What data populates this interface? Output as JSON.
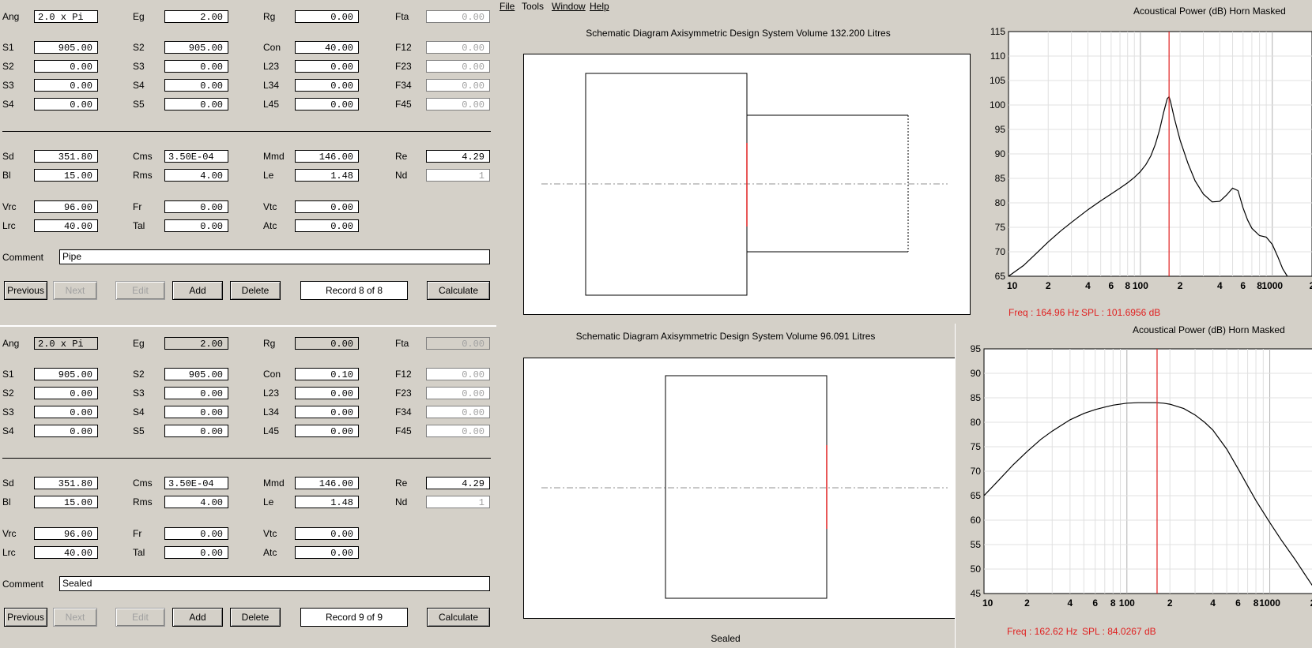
{
  "menu": {
    "file": "File",
    "tools": "Tools",
    "window": "Window",
    "help": "Help"
  },
  "records": [
    {
      "fields": [
        [
          {
            "label": "Ang",
            "value": "2.0 x Pi",
            "align": "left"
          },
          {
            "label": "Eg",
            "value": "2.00"
          },
          {
            "label": "Rg",
            "value": "0.00"
          },
          {
            "label": "Fta",
            "value": "0.00",
            "disabled": true
          }
        ],
        [
          {
            "label": "S1",
            "value": "905.00"
          },
          {
            "label": "S2",
            "value": "905.00"
          },
          {
            "label": "Con",
            "value": "40.00"
          },
          {
            "label": "F12",
            "value": "0.00",
            "disabled": true
          }
        ],
        [
          {
            "label": "S2",
            "value": "0.00"
          },
          {
            "label": "S3",
            "value": "0.00"
          },
          {
            "label": "L23",
            "value": "0.00"
          },
          {
            "label": "F23",
            "value": "0.00",
            "disabled": true
          }
        ],
        [
          {
            "label": "S3",
            "value": "0.00"
          },
          {
            "label": "S4",
            "value": "0.00"
          },
          {
            "label": "L34",
            "value": "0.00"
          },
          {
            "label": "F34",
            "value": "0.00",
            "disabled": true
          }
        ],
        [
          {
            "label": "S4",
            "value": "0.00"
          },
          {
            "label": "S5",
            "value": "0.00"
          },
          {
            "label": "L45",
            "value": "0.00"
          },
          {
            "label": "F45",
            "value": "0.00",
            "disabled": true
          }
        ],
        [
          {
            "label": "Sd",
            "value": "351.80"
          },
          {
            "label": "Cms",
            "value": "3.50E-04",
            "align": "left"
          },
          {
            "label": "Mmd",
            "value": "146.00"
          },
          {
            "label": "Re",
            "value": "4.29"
          }
        ],
        [
          {
            "label": "Bl",
            "value": "15.00"
          },
          {
            "label": "Rms",
            "value": "4.00"
          },
          {
            "label": "Le",
            "value": "1.48"
          },
          {
            "label": "Nd",
            "value": "1",
            "disabled": true
          }
        ],
        [
          {
            "label": "Vrc",
            "value": "96.00"
          },
          {
            "label": "Fr",
            "value": "0.00"
          },
          {
            "label": "Vtc",
            "value": "0.00"
          }
        ],
        [
          {
            "label": "Lrc",
            "value": "40.00"
          },
          {
            "label": "Tal",
            "value": "0.00"
          },
          {
            "label": "Atc",
            "value": "0.00"
          }
        ]
      ],
      "comment_label": "Comment",
      "comment": "Pipe",
      "buttons": {
        "previous": "Previous",
        "next": "Next",
        "edit": "Edit",
        "add": "Add",
        "delete": "Delete",
        "calculate": "Calculate"
      },
      "record": "Record 8 of 8",
      "schematic_caption": "Schematic Diagram   Axisymmetric Design   System Volume 132.200 Litres",
      "footer": ""
    },
    {
      "fields": [
        [
          {
            "label": "Ang",
            "value": "2.0 x Pi",
            "align": "left",
            "gray": true
          },
          {
            "label": "Eg",
            "value": "2.00",
            "gray": true
          },
          {
            "label": "Rg",
            "value": "0.00",
            "gray": true
          },
          {
            "label": "Fta",
            "value": "0.00",
            "disabled": true,
            "gray": true
          }
        ],
        [
          {
            "label": "S1",
            "value": "905.00"
          },
          {
            "label": "S2",
            "value": "905.00"
          },
          {
            "label": "Con",
            "value": "0.10"
          },
          {
            "label": "F12",
            "value": "0.00",
            "disabled": true
          }
        ],
        [
          {
            "label": "S2",
            "value": "0.00"
          },
          {
            "label": "S3",
            "value": "0.00"
          },
          {
            "label": "L23",
            "value": "0.00"
          },
          {
            "label": "F23",
            "value": "0.00",
            "disabled": true
          }
        ],
        [
          {
            "label": "S3",
            "value": "0.00"
          },
          {
            "label": "S4",
            "value": "0.00"
          },
          {
            "label": "L34",
            "value": "0.00"
          },
          {
            "label": "F34",
            "value": "0.00",
            "disabled": true
          }
        ],
        [
          {
            "label": "S4",
            "value": "0.00"
          },
          {
            "label": "S5",
            "value": "0.00"
          },
          {
            "label": "L45",
            "value": "0.00"
          },
          {
            "label": "F45",
            "value": "0.00",
            "disabled": true
          }
        ],
        [
          {
            "label": "Sd",
            "value": "351.80"
          },
          {
            "label": "Cms",
            "value": "3.50E-04",
            "align": "left"
          },
          {
            "label": "Mmd",
            "value": "146.00"
          },
          {
            "label": "Re",
            "value": "4.29"
          }
        ],
        [
          {
            "label": "Bl",
            "value": "15.00"
          },
          {
            "label": "Rms",
            "value": "4.00"
          },
          {
            "label": "Le",
            "value": "1.48"
          },
          {
            "label": "Nd",
            "value": "1",
            "disabled": true
          }
        ],
        [
          {
            "label": "Vrc",
            "value": "96.00"
          },
          {
            "label": "Fr",
            "value": "0.00"
          },
          {
            "label": "Vtc",
            "value": "0.00"
          }
        ],
        [
          {
            "label": "Lrc",
            "value": "40.00"
          },
          {
            "label": "Tal",
            "value": "0.00"
          },
          {
            "label": "Atc",
            "value": "0.00"
          }
        ]
      ],
      "comment_label": "Comment",
      "comment": "Sealed",
      "buttons": {
        "previous": "Previous",
        "next": "Next",
        "edit": "Edit",
        "add": "Add",
        "delete": "Delete",
        "calculate": "Calculate"
      },
      "record": "Record 9 of 9",
      "schematic_caption": "Schematic Diagram   Axisymmetric Design   System Volume 96.091 Litres",
      "footer": "Sealed"
    }
  ],
  "colors": {
    "marker": "#e02020",
    "curve": "#000000",
    "gridMajor": "#b0b0b0",
    "gridMinor": "#e0e0e0",
    "centerline": "#909090",
    "panel": "#d4d0c8"
  },
  "chart_data": [
    {
      "type": "line",
      "title": "Acoustical Power (dB)   Horn   Masked",
      "xscale": "log",
      "xlim": [
        10,
        2000
      ],
      "x_ticks": [
        10,
        20,
        40,
        60,
        80,
        100,
        200,
        400,
        600,
        800,
        1000,
        2000
      ],
      "x_tick_labels": [
        "10",
        "2",
        "4",
        "6",
        "8",
        "100",
        "2",
        "4",
        "6",
        "8",
        "1000",
        "2"
      ],
      "ylim": [
        65,
        115
      ],
      "y_ticks": [
        65,
        70,
        75,
        80,
        85,
        90,
        95,
        100,
        105,
        110,
        115
      ],
      "marker_x": 164.96,
      "readout": {
        "freq": "Freq : 164.96 Hz",
        "spl": "SPL : 101.6956 dB"
      },
      "series": [
        {
          "x": [
            10,
            13,
            16,
            20,
            25,
            30,
            40,
            50,
            60,
            70,
            80,
            90,
            100,
            110,
            120,
            130,
            140,
            150,
            160,
            165,
            170,
            180,
            200,
            230,
            260,
            300,
            350,
            400,
            450,
            500,
            550,
            600,
            650,
            700,
            800,
            900,
            1000,
            1100,
            1200,
            1300
          ],
          "y": [
            65,
            67.2,
            69.5,
            72,
            74.3,
            76,
            78.6,
            80.4,
            81.8,
            83,
            84.1,
            85.2,
            86.4,
            87.8,
            89.6,
            92,
            95,
            98.5,
            101.3,
            101.7,
            100.5,
            97.5,
            92.8,
            88,
            84.5,
            81.8,
            80.2,
            80.3,
            81.6,
            83,
            82.5,
            79,
            76.5,
            74.8,
            73.3,
            73,
            71.5,
            69,
            66.5,
            65
          ]
        }
      ]
    },
    {
      "type": "line",
      "title": "Acoustical Power (dB)   Horn   Masked",
      "xscale": "log",
      "xlim": [
        10,
        2000
      ],
      "x_ticks": [
        10,
        20,
        40,
        60,
        80,
        100,
        200,
        400,
        600,
        800,
        1000,
        2000
      ],
      "x_tick_labels": [
        "10",
        "2",
        "4",
        "6",
        "8",
        "100",
        "2",
        "4",
        "6",
        "8",
        "1000",
        "2"
      ],
      "ylim": [
        45,
        95
      ],
      "y_ticks": [
        45,
        50,
        55,
        60,
        65,
        70,
        75,
        80,
        85,
        90,
        95
      ],
      "marker_x": 162.62,
      "readout": {
        "freq": "Freq : 162.62 Hz",
        "spl": "SPL : 84.0267 dB"
      },
      "series": [
        {
          "x": [
            10,
            13,
            16,
            20,
            25,
            30,
            40,
            50,
            60,
            70,
            80,
            100,
            120,
            140,
            160,
            180,
            200,
            250,
            300,
            350,
            400,
            500,
            600,
            700,
            800,
            1000,
            1200,
            1500,
            1800,
            2000
          ],
          "y": [
            65,
            68.5,
            71.3,
            74,
            76.5,
            78.2,
            80.5,
            81.8,
            82.6,
            83.1,
            83.5,
            83.9,
            84,
            84,
            84,
            83.9,
            83.7,
            82.8,
            81.5,
            80,
            78.4,
            74.5,
            70.5,
            67,
            64,
            59.5,
            56,
            52,
            48.5,
            46.5
          ]
        }
      ]
    }
  ]
}
